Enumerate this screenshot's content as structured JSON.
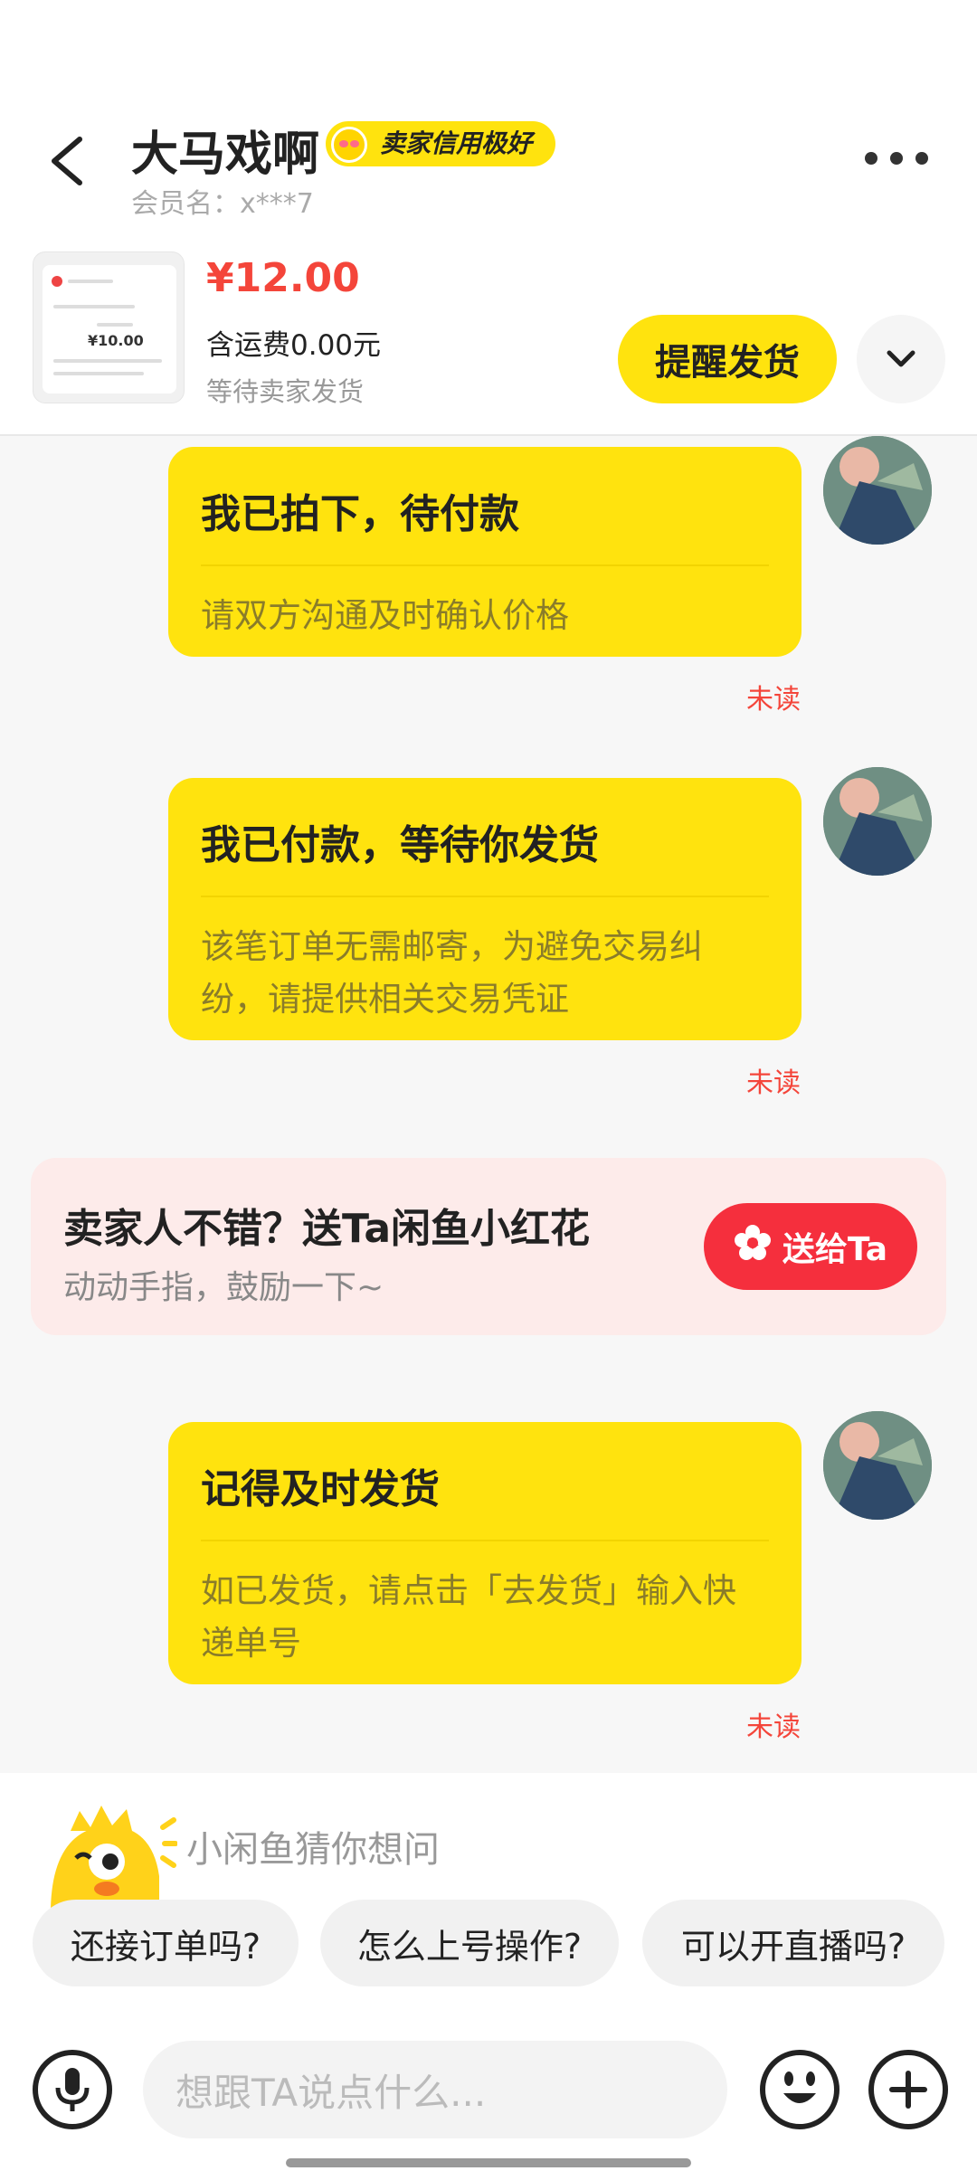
{
  "header": {
    "title": "大马戏啊",
    "badge": "卖家信用极好",
    "member": "会员名：x***7"
  },
  "product": {
    "price": "¥12.00",
    "shipping": "含运费0.00元",
    "status": "等待卖家发货",
    "thumb_amount": "¥10.00",
    "remind_label": "提醒发货"
  },
  "messages": [
    {
      "title": "我已拍下，待付款",
      "body": "请双方沟通及时确认价格",
      "read_state": "未读"
    },
    {
      "title": "我已付款，等待你发货",
      "body": "该笔订单无需邮寄，为避免交易纠纷，请提供相关交易凭证",
      "read_state": "未读"
    },
    {
      "title": "记得及时发货",
      "body": "如已发货，请点击「去发货」输入快递单号",
      "read_state": "未读"
    }
  ],
  "promo": {
    "title": "卖家人不错？送Ta闲鱼小红花",
    "subtitle": "动动手指，鼓励一下~",
    "button": "送给Ta"
  },
  "suggestions": {
    "title": "小闲鱼猜你想问",
    "chips": [
      "还接订单吗?",
      "怎么上号操作?",
      "可以开直播吗?"
    ]
  },
  "input": {
    "placeholder": "想跟TA说点什么..."
  },
  "icons": {
    "back": "back-arrow-icon",
    "more": "more-icon",
    "expand": "chevron-down-icon",
    "flower": "flower-icon",
    "mic": "mic-icon",
    "emoji": "emoji-icon",
    "plus": "plus-icon"
  },
  "colors": {
    "accent": "#ffe30e",
    "price": "#f4453a",
    "promo_button": "#f52f3d"
  }
}
